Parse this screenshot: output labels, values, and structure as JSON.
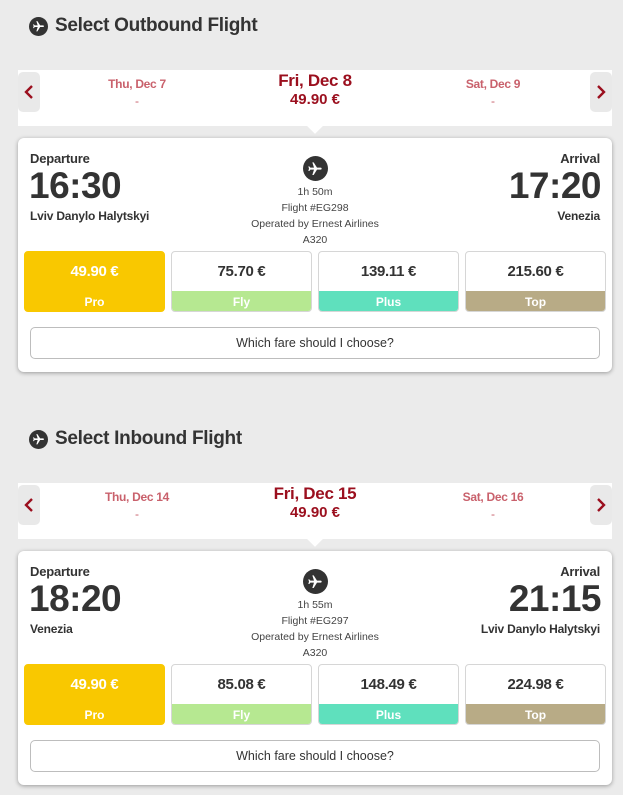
{
  "outbound": {
    "title": "Select Outbound Flight",
    "title_icon": "plane-icon",
    "dates": {
      "prev": {
        "date": "Thu, Dec 7",
        "price": "-"
      },
      "current": {
        "date": "Fri, Dec 8",
        "price": "49.90 €"
      },
      "next": {
        "date": "Sat, Dec 9",
        "price": "-"
      }
    },
    "flight": {
      "departure_label": "Departure",
      "departure_time": "16:30",
      "departure_airport": "Lviv Danylo Halytskyi",
      "arrival_label": "Arrival",
      "arrival_time": "17:20",
      "arrival_airport": "Venezia",
      "duration": "1h 50m",
      "flight_no": "Flight #EG298",
      "operator": "Operated by Ernest Airlines",
      "aircraft": "A320"
    },
    "fares": [
      {
        "price": "49.90 €",
        "name": "Pro",
        "color": "#f9c800",
        "selected": true
      },
      {
        "price": "75.70 €",
        "name": "Fly",
        "color": "#b6e891",
        "selected": false
      },
      {
        "price": "139.11 €",
        "name": "Plus",
        "color": "#5fe0bd",
        "selected": false
      },
      {
        "price": "215.60 €",
        "name": "Top",
        "color": "#b8ab86",
        "selected": false
      }
    ],
    "help_button": "Which fare should I choose?"
  },
  "inbound": {
    "title": "Select Inbound Flight",
    "title_icon": "plane-icon",
    "dates": {
      "prev": {
        "date": "Thu, Dec 14",
        "price": "-"
      },
      "current": {
        "date": "Fri, Dec 15",
        "price": "49.90 €"
      },
      "next": {
        "date": "Sat, Dec 16",
        "price": "-"
      }
    },
    "flight": {
      "departure_label": "Departure",
      "departure_time": "18:20",
      "departure_airport": "Venezia",
      "arrival_label": "Arrival",
      "arrival_time": "21:15",
      "arrival_airport": "Lviv Danylo Halytskyi",
      "duration": "1h 55m",
      "flight_no": "Flight #EG297",
      "operator": "Operated by Ernest Airlines",
      "aircraft": "A320"
    },
    "fares": [
      {
        "price": "49.90 €",
        "name": "Pro",
        "color": "#f9c800",
        "selected": true
      },
      {
        "price": "85.08 €",
        "name": "Fly",
        "color": "#b6e891",
        "selected": false
      },
      {
        "price": "148.49 €",
        "name": "Plus",
        "color": "#5fe0bd",
        "selected": false
      },
      {
        "price": "224.98 €",
        "name": "Top",
        "color": "#b8ab86",
        "selected": false
      }
    ],
    "help_button": "Which fare should I choose?"
  },
  "colors": {
    "accent_red": "#9b0f1e",
    "side_date": "#c9616c",
    "pro": "#f9c800",
    "fly": "#b6e891",
    "plus": "#5fe0bd",
    "top": "#b8ab86"
  }
}
